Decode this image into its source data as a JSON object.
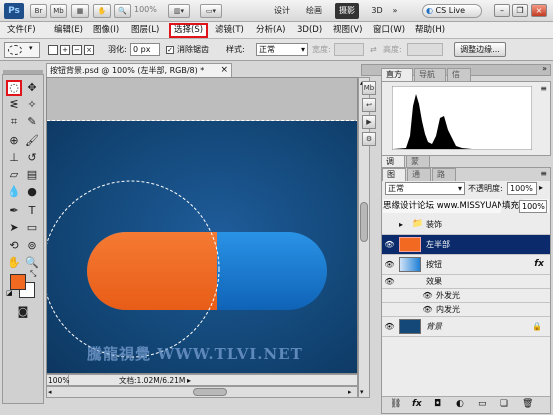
{
  "appbar": {
    "logo": "Ps",
    "buttons": [
      "Br",
      "Mb"
    ],
    "zoom": "100%",
    "workspaces": [
      "设计",
      "绘画",
      "摄影",
      "3D"
    ],
    "active_workspace": "摄影",
    "cslive": "CS Live"
  },
  "menu": {
    "items": [
      "文件(F)",
      "编辑(E)",
      "图像(I)",
      "图层(L)",
      "选择(S)",
      "滤镜(T)",
      "分析(A)",
      "3D(D)",
      "视图(V)",
      "窗口(W)",
      "帮助(H)"
    ],
    "selected_index": 4
  },
  "options": {
    "feather_label": "羽化:",
    "feather_value": "0 px",
    "antialias_label": "消除锯齿",
    "antialias_checked": true,
    "style_label": "样式:",
    "style_value": "正常",
    "width_label": "宽度:",
    "height_label": "高度:",
    "refine_button": "调整边缘..."
  },
  "document": {
    "tab_title": "按钮背景.psd @ 100% (左半部, RGB/8) *",
    "close": "×",
    "zoom": "100%",
    "doc_size": "文档:1.02M/6.21M",
    "watermark": "騰龍視覺 WWW.TLVI.NET",
    "colors": {
      "orange": "#f26a21",
      "blue": "#1f7fd6"
    }
  },
  "histogram_panel": {
    "tabs": [
      "直方图",
      "导航器",
      "信息"
    ],
    "active_tab": 0
  },
  "adjust_tabs": [
    "调整",
    "蒙版"
  ],
  "layers_panel": {
    "tabs": [
      "图层",
      "通道",
      "路径"
    ],
    "active_tab": 0,
    "blend_mode": "正常",
    "opacity_label": "不透明度:",
    "opacity_value": "100%",
    "watermark": "思缘设计论坛 www.MISSYUAN.com",
    "fill_label": "填充:",
    "fill_value": "100%",
    "layers": [
      {
        "name": "装饰",
        "type": "group"
      },
      {
        "name": "左半部",
        "type": "layer",
        "selected": true
      },
      {
        "name": "按钮",
        "type": "layer",
        "fx": "fx"
      },
      {
        "name": "效果",
        "type": "effects-header"
      },
      {
        "name": "外发光",
        "type": "effect"
      },
      {
        "name": "内发光",
        "type": "effect"
      },
      {
        "name": "背景",
        "type": "background",
        "lock": true
      }
    ]
  }
}
